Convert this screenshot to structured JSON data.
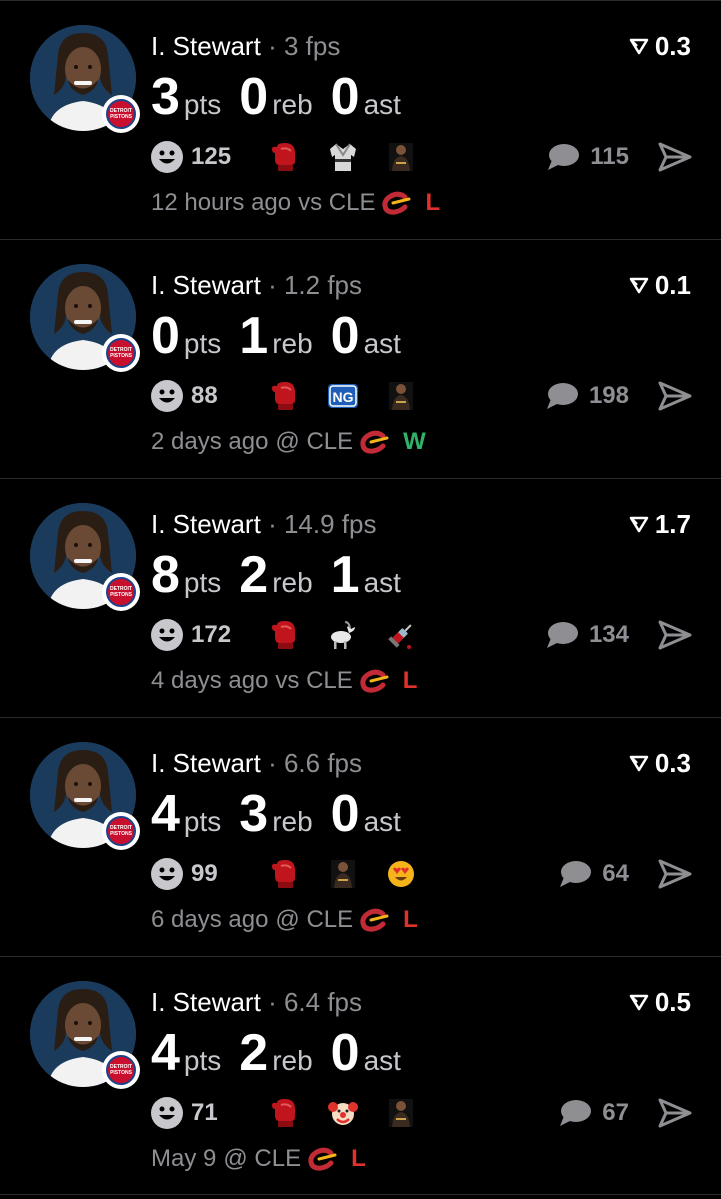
{
  "colors": {
    "background": "#000000",
    "loss": "#e0322d",
    "win": "#2fb36b",
    "muted": "#8e8e93"
  },
  "posts": [
    {
      "player": "I. Stewart",
      "separator": "·",
      "fps": "3 fps",
      "score": "0.3",
      "pts": "3",
      "reb": "0",
      "ast": "0",
      "pts_label": "pts",
      "reb_label": "reb",
      "ast_label": "ast",
      "reaction_count": "125",
      "emojis": [
        "boxing-glove-icon",
        "gi-icon",
        "player-photo-icon"
      ],
      "comment_count": "115",
      "time": "12 hours ago",
      "venue": "vs CLE",
      "result": "L",
      "result_type": "loss"
    },
    {
      "player": "I. Stewart",
      "separator": "·",
      "fps": "1.2 fps",
      "score": "0.1",
      "pts": "0",
      "reb": "1",
      "ast": "0",
      "pts_label": "pts",
      "reb_label": "reb",
      "ast_label": "ast",
      "reaction_count": "88",
      "emojis": [
        "boxing-glove-icon",
        "ng-badge-icon",
        "player-photo-icon"
      ],
      "ng_text": "NG",
      "comment_count": "198",
      "time": "2 days ago",
      "venue": "@ CLE",
      "result": "W",
      "result_type": "win"
    },
    {
      "player": "I. Stewart",
      "separator": "·",
      "fps": "14.9 fps",
      "score": "1.7",
      "pts": "8",
      "reb": "2",
      "ast": "1",
      "pts_label": "pts",
      "reb_label": "reb",
      "ast_label": "ast",
      "reaction_count": "172",
      "emojis": [
        "boxing-glove-icon",
        "goat-icon",
        "syringe-icon"
      ],
      "comment_count": "134",
      "time": "4 days ago",
      "venue": "vs CLE",
      "result": "L",
      "result_type": "loss"
    },
    {
      "player": "I. Stewart",
      "separator": "·",
      "fps": "6.6 fps",
      "score": "0.3",
      "pts": "4",
      "reb": "3",
      "ast": "0",
      "pts_label": "pts",
      "reb_label": "reb",
      "ast_label": "ast",
      "reaction_count": "99",
      "emojis": [
        "boxing-glove-icon",
        "player-photo-icon",
        "heart-eyes-icon"
      ],
      "comment_count": "64",
      "time": "6 days ago",
      "venue": "@ CLE",
      "result": "L",
      "result_type": "loss"
    },
    {
      "player": "I. Stewart",
      "separator": "·",
      "fps": "6.4 fps",
      "score": "0.5",
      "pts": "4",
      "reb": "2",
      "ast": "0",
      "pts_label": "pts",
      "reb_label": "reb",
      "ast_label": "ast",
      "reaction_count": "71",
      "emojis": [
        "boxing-glove-icon",
        "clown-icon",
        "player-photo-icon"
      ],
      "comment_count": "67",
      "time": "May 9",
      "venue": "@ CLE",
      "result": "L",
      "result_type": "loss"
    }
  ],
  "team_badge": {
    "line1": "DETROIT",
    "line2": "PISTONS"
  }
}
